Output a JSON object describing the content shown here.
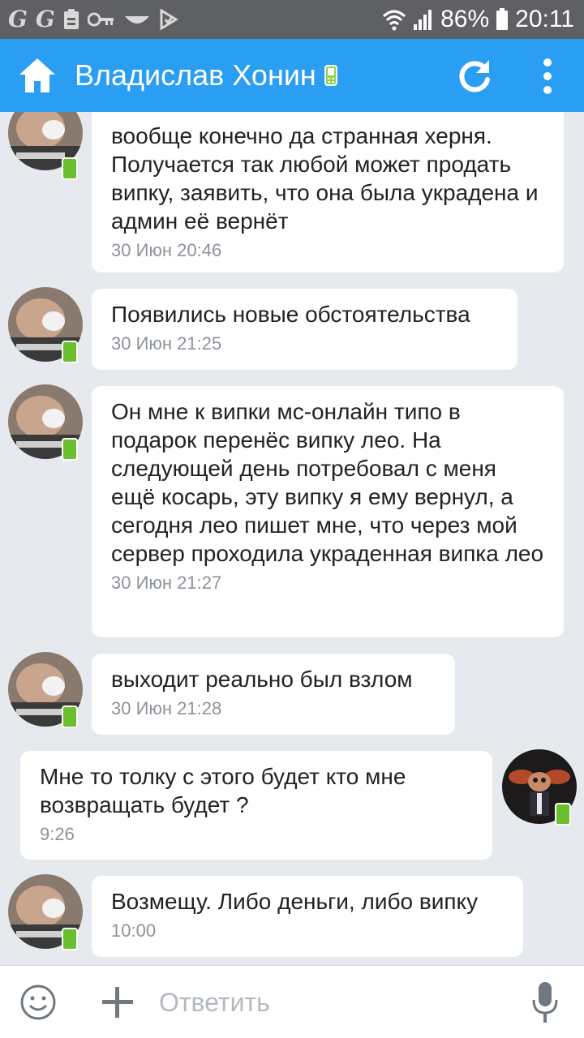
{
  "status_bar": {
    "battery": "86%",
    "time": "20:11"
  },
  "header": {
    "title": "Владислав Хонин"
  },
  "messages": [
    {
      "from": "contact",
      "text": "вообще конечно да странная херня. Получается так любой может продать випку, заявить, что она была украдена и админ её вернёт",
      "time": "30 Июн 20:46"
    },
    {
      "from": "contact",
      "text": "Появились новые обстоятельства",
      "time": "30 Июн 21:25"
    },
    {
      "from": "contact",
      "text": "Он мне к випки мс-онлайн типо в подарок перенёс випку лео. На следующей день потребовал с меня ещё косарь, эту випку я ему вернул, а сегодня лео пишет мне, что через мой сервер проходила украденная випка лео",
      "time": "30 Июн 21:27"
    },
    {
      "from": "contact",
      "text": "выходит реально был взлом",
      "time": "30 Июн 21:28"
    },
    {
      "from": "me",
      "text": "Мне то толку с этого будет кто мне возвращать будет ?",
      "time": "9:26"
    },
    {
      "from": "contact",
      "text": "Возмещу. Либо деньги, либо випку",
      "time": "10:00"
    }
  ],
  "composer": {
    "placeholder": "Ответить"
  },
  "colors": {
    "app_bar": "#2a9ef2",
    "status_bar": "#5f6063",
    "chat_background": "#e6e9ee",
    "online_badge": "#6bbf2e"
  },
  "icons": [
    "home-icon",
    "mobile-online-icon",
    "refresh-icon",
    "more-vert-icon",
    "emoji-icon",
    "plus-icon",
    "mic-icon"
  ]
}
